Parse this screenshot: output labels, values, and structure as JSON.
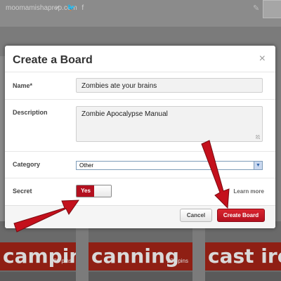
{
  "background": {
    "handle": "moomamishaprep.com",
    "social_icons": [
      "pinterest-icon",
      "twitter-icon",
      "facebook-icon"
    ],
    "boards": [
      {
        "name": "camping",
        "pins": "286 pins"
      },
      {
        "name": "canning",
        "pins": "223 pins"
      },
      {
        "name": "cast iro",
        "pins": ""
      }
    ]
  },
  "modal": {
    "title": "Create a Board",
    "close": "×",
    "name_label": "Name*",
    "name_value": "Zombies ate your brains",
    "description_label": "Description",
    "description_value": "Zombie Apocalypse Manual",
    "category_label": "Category",
    "category_value": "Other",
    "secret_label": "Secret",
    "secret_toggle": "Yes",
    "learn_more": "Learn more",
    "cancel_button": "Cancel",
    "create_button": "Create Board"
  },
  "colors": {
    "accent": "#b3101f",
    "arrow": "#c4101c"
  }
}
